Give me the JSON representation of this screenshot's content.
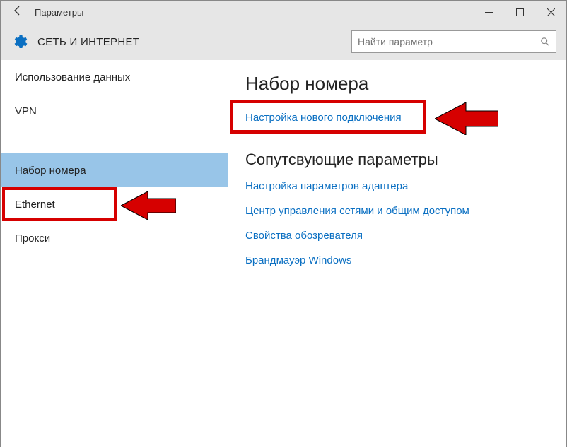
{
  "titlebar": {
    "title": "Параметры"
  },
  "header": {
    "heading": "СЕТЬ И ИНТЕРНЕТ",
    "search_placeholder": "Найти параметр"
  },
  "sidebar": {
    "items": [
      {
        "label": "Использование данных"
      },
      {
        "label": "VPN"
      },
      {
        "label": "Набор номера"
      },
      {
        "label": "Ethernet"
      },
      {
        "label": "Прокси"
      }
    ]
  },
  "main": {
    "heading": "Набор номера",
    "link_new_connection": "Настройка нового подключения",
    "related_heading": "Сопутсвующие параметры",
    "links": [
      "Настройка параметров адаптера",
      "Центр управления сетями и общим доступом",
      "Свойства обозревателя",
      "Брандмауэр Windows"
    ]
  },
  "colors": {
    "accent": "#0a6fc2",
    "highlight": "#d60000"
  }
}
